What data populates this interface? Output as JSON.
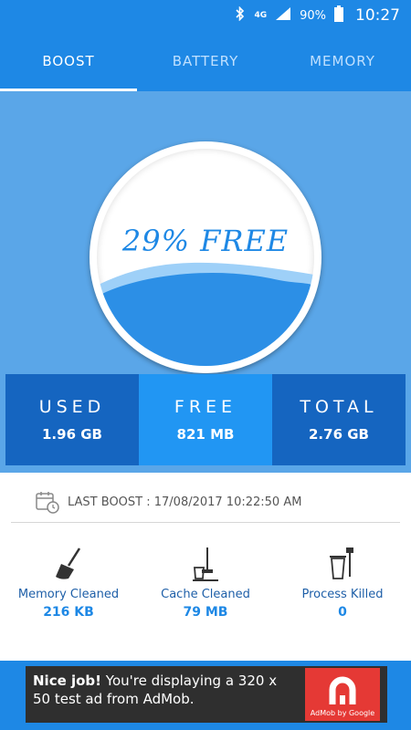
{
  "status_bar": {
    "network": "4G",
    "battery": "90%",
    "time": "10:27",
    "icons": [
      "bluetooth-icon",
      "signal-icon",
      "battery-icon"
    ]
  },
  "tabs": [
    {
      "label": "BOOST",
      "active": true
    },
    {
      "label": "BATTERY",
      "active": false
    },
    {
      "label": "MEMORY",
      "active": false
    }
  ],
  "gauge": {
    "text": "29% FREE",
    "free_fraction": 0.29
  },
  "stats": [
    {
      "label": "USED",
      "value": "1.96 GB"
    },
    {
      "label": "FREE",
      "value": "821 MB"
    },
    {
      "label": "TOTAL",
      "value": "2.76 GB"
    }
  ],
  "last_boost": {
    "text": "LAST BOOST : 17/08/2017 10:22:50 AM",
    "icon": "calendar-clock-icon"
  },
  "metrics": [
    {
      "label": "Memory Cleaned",
      "value": "216 KB",
      "icon": "broom-icon"
    },
    {
      "label": "Cache Cleaned",
      "value": "79 MB",
      "icon": "mop-bucket-icon"
    },
    {
      "label": "Process Killed",
      "value": "0",
      "icon": "trash-brush-icon"
    }
  ],
  "ad": {
    "headline": "Nice job!",
    "body": "You're displaying a 320 x 50 test ad from AdMob.",
    "brand": "AdMob by Google"
  },
  "colors": {
    "primary": "#1e88e5",
    "hero_bg": "#5aa6e8",
    "dark_block": "#1565c0",
    "light_block": "#2196f3",
    "ad_bg": "#2f2f2f",
    "ad_logo": "#e53935"
  }
}
